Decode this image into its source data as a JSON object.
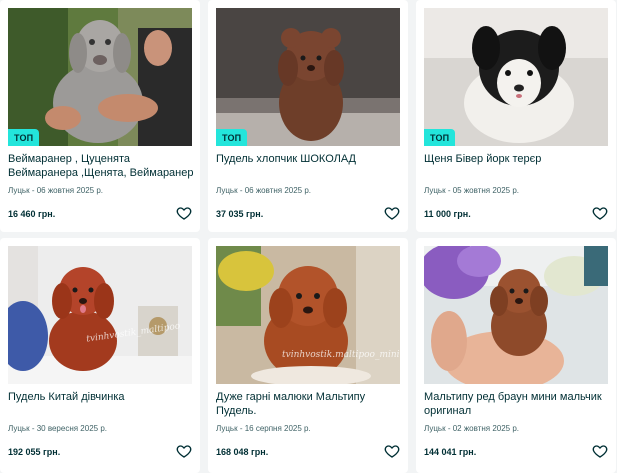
{
  "listings": [
    {
      "title": "Веймаранер , Цуценята Веймаранера ,Щенята, Веймаранер",
      "meta": "Луцьк - 06 жовтня 2025 р.",
      "price": "16 460 грн.",
      "badge": "ТОП",
      "image_icon": "weimaraner-puppy-photo"
    },
    {
      "title": "Пудель хлопчик ШОКОЛАД",
      "meta": "Луцьк - 06 жовтня 2025 р.",
      "price": "37 035 грн.",
      "badge": "ТОП",
      "image_icon": "brown-poodle-photo"
    },
    {
      "title": "Щеня Бівер йорк терєр",
      "meta": "Луцьк - 05 жовтня 2025 р.",
      "price": "11 000 грн.",
      "badge": "ТОП",
      "image_icon": "biewer-yorkie-photo"
    },
    {
      "title": "Пудель Китай дівчинка",
      "meta": "Луцьк - 30 вересня 2025 р.",
      "price": "192 055 грн.",
      "badge": "",
      "image_icon": "red-poodle-photo",
      "watermark": "tvinhvostik_maltipoo"
    },
    {
      "title": "Дуже гарні малюки Мальтипу Пудель.",
      "meta": "Луцьк - 16 серпня 2025 р.",
      "price": "168 048 грн.",
      "badge": "",
      "image_icon": "maltipoo-puppy-photo",
      "watermark": "tvinhvostik.maltipoo_mini"
    },
    {
      "title": "Мальтипу ред браун мини мальчик оригинал",
      "meta": "Луцьк - 02 жовтня 2025 р.",
      "price": "144 041 грн.",
      "badge": "",
      "image_icon": "maltipoo-in-hand-photo"
    }
  ],
  "colors": {
    "accent_badge": "#23e5db",
    "text": "#002f34",
    "meta_text": "#406367",
    "background": "#f2f4f5"
  },
  "favorite_icon": "heart-outline-icon"
}
